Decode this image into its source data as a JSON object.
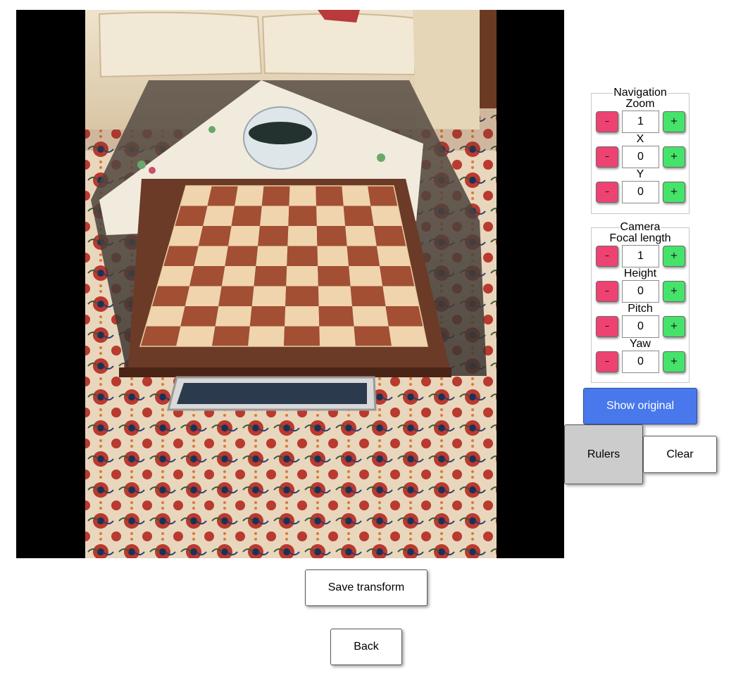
{
  "navigation": {
    "legend": "Navigation",
    "controls": [
      {
        "label": "Zoom",
        "value": "1",
        "minus": "–",
        "plus": "+"
      },
      {
        "label": "X",
        "value": "0",
        "minus": "–",
        "plus": "+"
      },
      {
        "label": "Y",
        "value": "0",
        "minus": "–",
        "plus": "+"
      }
    ]
  },
  "camera": {
    "legend": "Camera",
    "controls": [
      {
        "label": "Focal length",
        "value": "1",
        "minus": "–",
        "plus": "+"
      },
      {
        "label": "Height",
        "value": "0",
        "minus": "–",
        "plus": "+"
      },
      {
        "label": "Pitch",
        "value": "0",
        "minus": "–",
        "plus": "+"
      },
      {
        "label": "Yaw",
        "value": "0",
        "minus": "–",
        "plus": "+"
      }
    ]
  },
  "buttons": {
    "show_original": "Show original",
    "rulers": "Rulers",
    "clear": "Clear",
    "save_transform": "Save transform",
    "back": "Back"
  },
  "colors": {
    "minus_button": "#ee4372",
    "plus_button": "#45e36a",
    "primary_button": "#4878ec",
    "active_toggle": "#cccccc",
    "viewport_background": "#000000"
  }
}
